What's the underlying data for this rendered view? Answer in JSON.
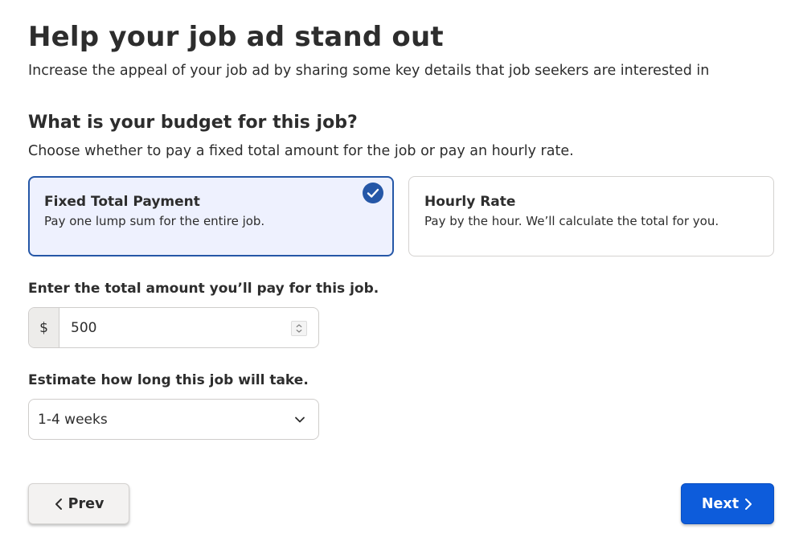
{
  "header": {
    "title": "Help your job ad stand out",
    "subtitle": "Increase the appeal of your job ad by sharing some key details that job seekers are interested in"
  },
  "budget": {
    "question": "What is your budget for this job?",
    "description": "Choose whether to pay a fixed total amount for the job or pay an hourly rate.",
    "options": [
      {
        "title": "Fixed Total Payment",
        "description": "Pay one lump sum for the entire job.",
        "selected": true
      },
      {
        "title": "Hourly Rate",
        "description": "Pay by the hour. We’ll calculate the total for you.",
        "selected": false
      }
    ]
  },
  "amount": {
    "label": "Enter the total amount you’ll pay for this job.",
    "currency_symbol": "$",
    "value": "500"
  },
  "duration": {
    "label": "Estimate how long this job will take.",
    "selected": "1-4 weeks"
  },
  "nav": {
    "prev_label": "Prev",
    "next_label": "Next"
  },
  "colors": {
    "accent": "#2557a7",
    "selected_bg": "#eef1fe",
    "next_button": "#0d5cdb"
  }
}
